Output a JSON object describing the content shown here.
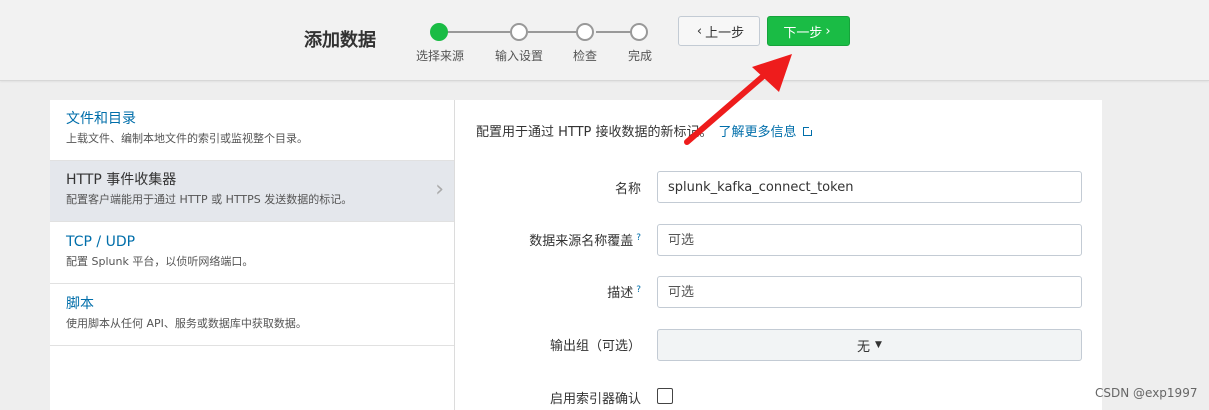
{
  "header": {
    "title": "添加数据",
    "steps": [
      {
        "label": "选择来源",
        "active": true
      },
      {
        "label": "输入设置",
        "active": false
      },
      {
        "label": "检查",
        "active": false
      },
      {
        "label": "完成",
        "active": false
      }
    ],
    "prev_label": "上一步",
    "next_label": "下一步"
  },
  "sources": [
    {
      "title": "文件和目录",
      "desc": "上载文件、编制本地文件的索引或监视整个目录。"
    },
    {
      "title": "HTTP 事件收集器",
      "desc": "配置客户端能用于通过 HTTP 或 HTTPS 发送数据的标记。",
      "selected": true
    },
    {
      "title": "TCP / UDP",
      "desc": "配置 Splunk 平台，以侦听网络端口。"
    },
    {
      "title": "脚本",
      "desc": "使用脚本从任何 API、服务或数据库中获取数据。"
    }
  ],
  "form": {
    "intro": "配置用于通过 HTTP 接收数据的新标记。",
    "learn_more": "了解更多信息",
    "name_label": "名称",
    "name_value": "splunk_kafka_connect_token",
    "source_override_label": "数据来源名称覆盖",
    "source_override_placeholder": "可选",
    "description_label": "描述",
    "description_placeholder": "可选",
    "help_mark": "?",
    "output_group_label": "输出组（可选）",
    "output_group_value": "无",
    "indexer_ack_label": "启用索引器确认"
  },
  "watermark": "CSDN @exp1997",
  "colors": {
    "accent_green": "#1abc45",
    "link_blue": "#006eaa",
    "arrow_red": "#ee1c1c"
  }
}
